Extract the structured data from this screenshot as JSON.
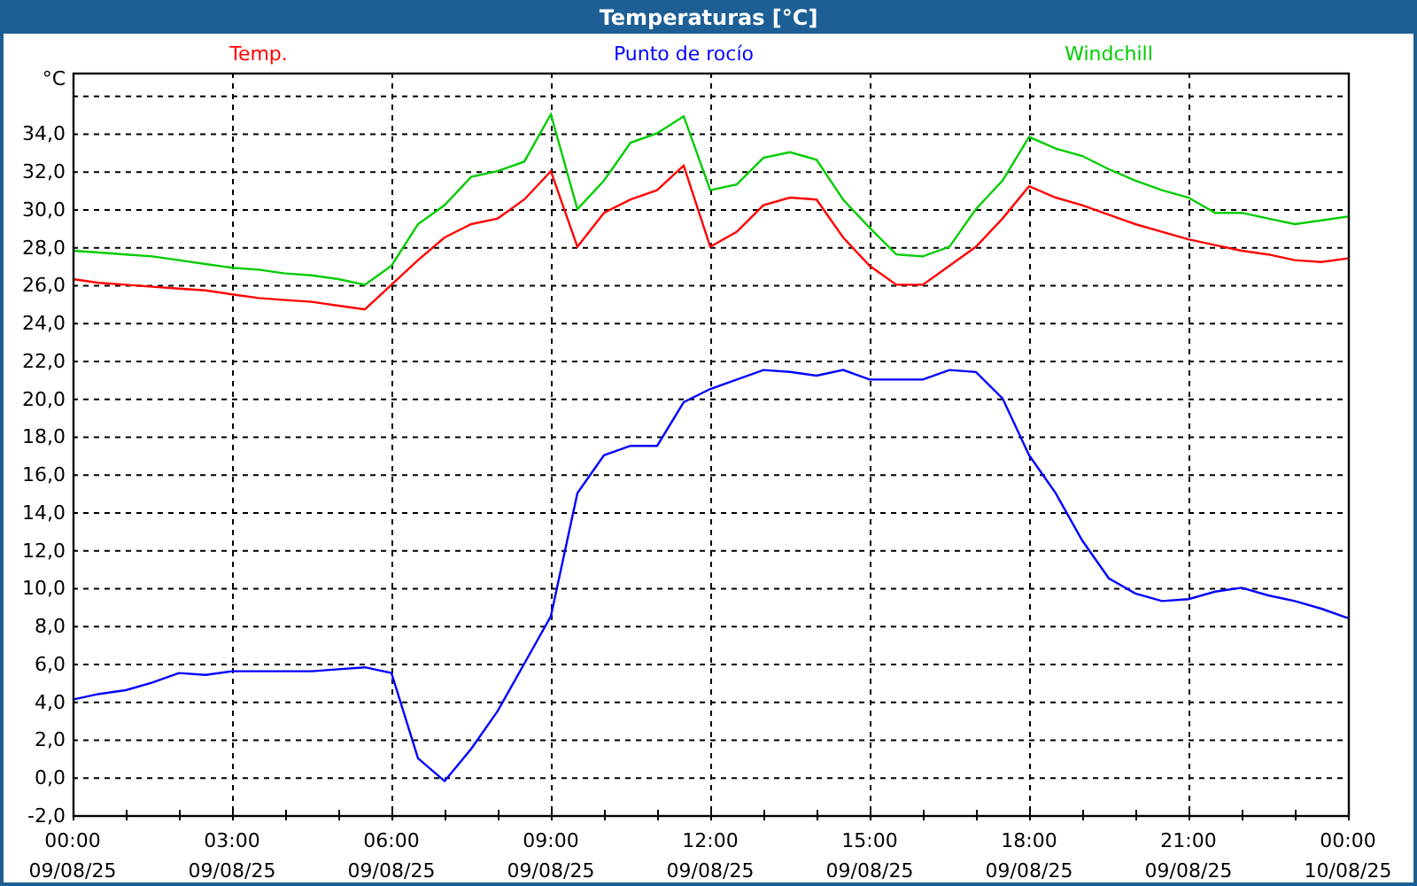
{
  "window": {
    "title": "Temperaturas [°C]"
  },
  "chart": {
    "chart_data": {
      "type": "line",
      "ylabel": "°C",
      "grid": true,
      "categories": [
        "00:00 09/08/25",
        null,
        null,
        null,
        null,
        null,
        "03:00 09/08/25",
        null,
        null,
        null,
        null,
        null,
        "06:00 09/08/25",
        null,
        null,
        null,
        null,
        null,
        "09:00 09/08/25",
        null,
        null,
        null,
        null,
        null,
        "12:00 09/08/25",
        null,
        null,
        null,
        null,
        null,
        "15:00 09/08/25",
        null,
        null,
        null,
        null,
        null,
        "18:00 09/08/25",
        null,
        null,
        null,
        null,
        null,
        "21:00 09/08/25",
        null,
        null,
        null,
        null,
        null,
        "00:00 10/08/25"
      ],
      "series": [
        {
          "name": "Temp.",
          "color": "#ff0000",
          "values": [
            26.3,
            26.1,
            26.0,
            25.9,
            25.8,
            25.7,
            25.5,
            25.3,
            25.2,
            25.1,
            24.9,
            24.7,
            26.0,
            27.3,
            28.5,
            29.2,
            29.5,
            30.5,
            32.0,
            28.0,
            29.8,
            30.5,
            31.0,
            32.3,
            28.0,
            28.8,
            30.2,
            30.6,
            30.5,
            28.5,
            27.0,
            26.0,
            26.0,
            27.0,
            28.0,
            29.5,
            31.2,
            30.6,
            30.2,
            29.7,
            29.2,
            28.8,
            28.4,
            28.1,
            27.8,
            27.6,
            27.3,
            27.2,
            27.4
          ]
        },
        {
          "name": "Punto de rocío",
          "color": "#0000ff",
          "values": [
            4.1,
            4.4,
            4.6,
            5.0,
            5.5,
            5.4,
            5.6,
            5.6,
            5.6,
            5.6,
            5.7,
            5.8,
            5.5,
            1.0,
            -0.2,
            1.5,
            3.5,
            6.0,
            8.5,
            15.0,
            17.0,
            17.5,
            17.5,
            19.8,
            20.5,
            21.0,
            21.5,
            21.4,
            21.2,
            21.5,
            21.0,
            21.0,
            21.0,
            21.5,
            21.4,
            20.0,
            17.0,
            15.0,
            12.5,
            10.5,
            9.7,
            9.3,
            9.4,
            9.8,
            10.0,
            9.6,
            9.3,
            8.9,
            8.4
          ]
        },
        {
          "name": "Windchill",
          "color": "#00cc00",
          "values": [
            27.8,
            27.7,
            27.6,
            27.5,
            27.3,
            27.1,
            26.9,
            26.8,
            26.6,
            26.5,
            26.3,
            26.0,
            27.0,
            29.2,
            30.2,
            31.7,
            32.0,
            32.5,
            35.0,
            30.0,
            31.5,
            33.5,
            34.0,
            34.9,
            31.0,
            31.3,
            32.7,
            33.0,
            32.6,
            30.5,
            29.0,
            27.6,
            27.5,
            28.0,
            30.0,
            31.5,
            33.8,
            33.2,
            32.8,
            32.1,
            31.5,
            31.0,
            30.6,
            29.8,
            29.8,
            29.5,
            29.2,
            29.4,
            29.6
          ]
        }
      ],
      "ylim": [
        -2,
        37.2
      ],
      "yticks": [
        {
          "value": -2,
          "label": "-2,0"
        },
        {
          "value": 0,
          "label": "0,0"
        },
        {
          "value": 2,
          "label": "2,0"
        },
        {
          "value": 4,
          "label": "4,0"
        },
        {
          "value": 6,
          "label": "6,0"
        },
        {
          "value": 8,
          "label": "8,0"
        },
        {
          "value": 10,
          "label": "10,0"
        },
        {
          "value": 12,
          "label": "12,0"
        },
        {
          "value": 14,
          "label": "14,0"
        },
        {
          "value": 16,
          "label": "16,0"
        },
        {
          "value": 18,
          "label": "18,0"
        },
        {
          "value": 20,
          "label": "20,0"
        },
        {
          "value": 22,
          "label": "22,0"
        },
        {
          "value": 24,
          "label": "24,0"
        },
        {
          "value": 26,
          "label": "26,0"
        },
        {
          "value": 28,
          "label": "28,0"
        },
        {
          "value": 30,
          "label": "30,0"
        },
        {
          "value": 32,
          "label": "32,0"
        },
        {
          "value": 34,
          "label": "34,0"
        }
      ]
    }
  }
}
